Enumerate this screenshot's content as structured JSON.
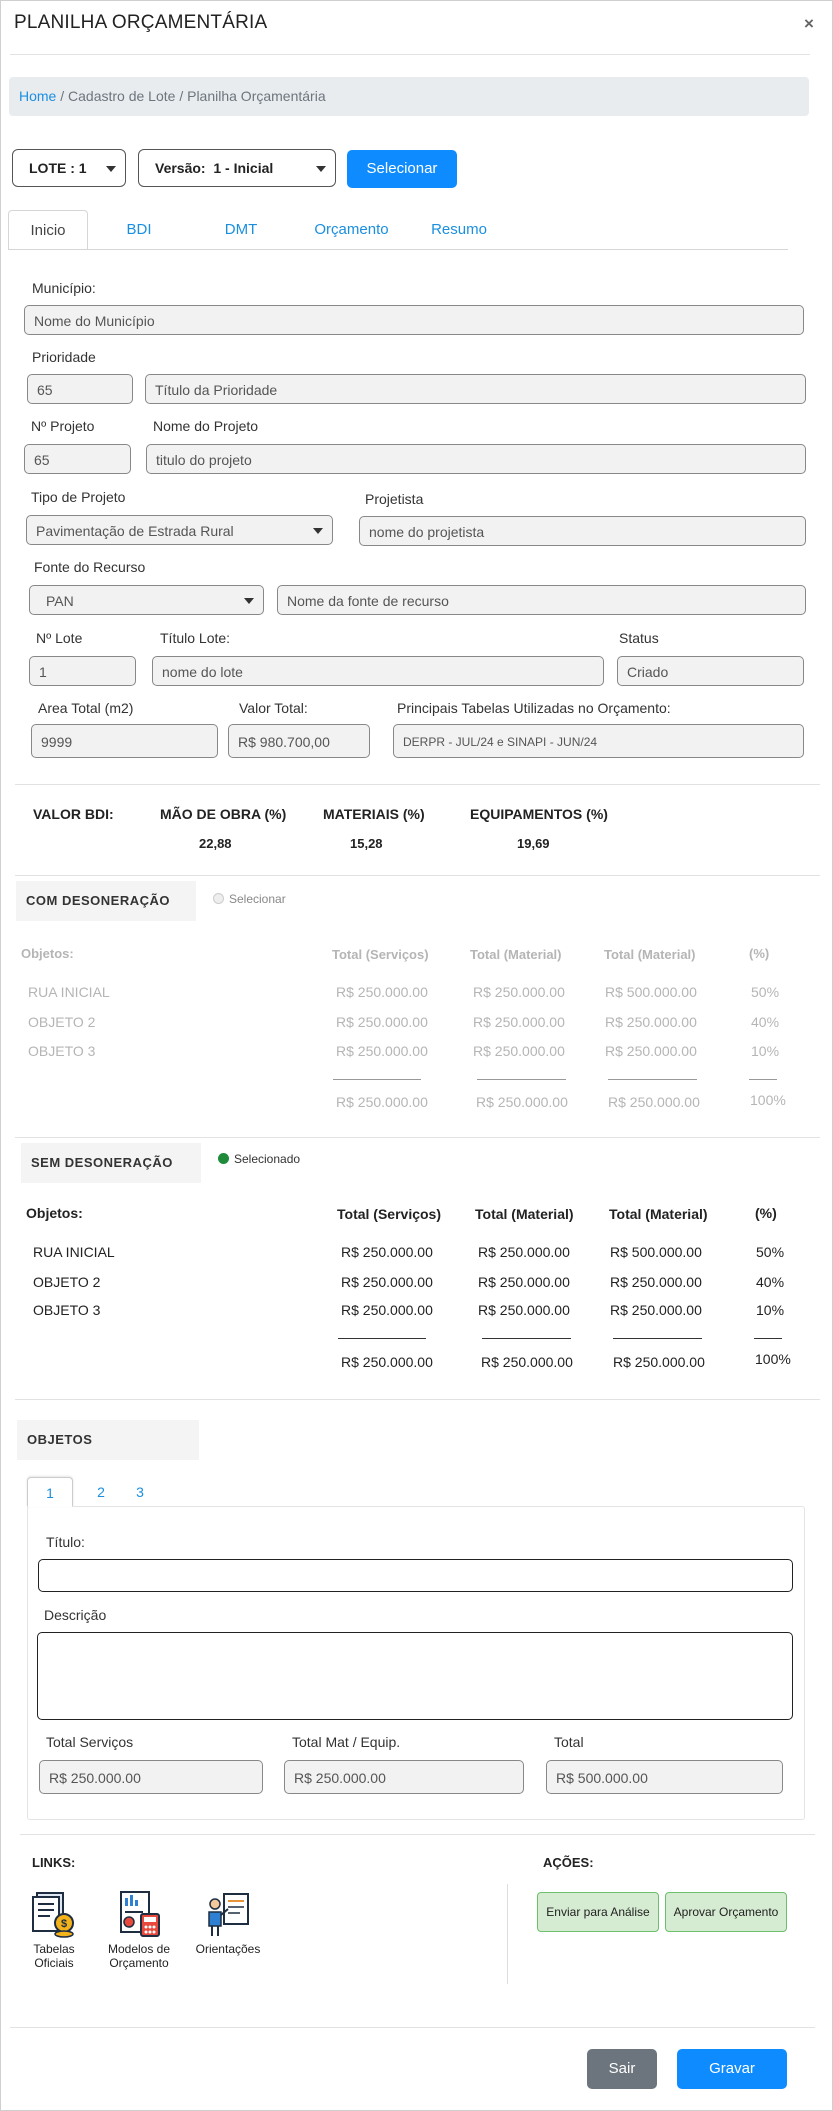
{
  "header": {
    "title": "PLANILHA ORÇAMENTÁRIA",
    "close": "×"
  },
  "breadcrumb": {
    "home": "Home",
    "rest": " / Cadastro de Lote / Planilha Orçamentária"
  },
  "selectors": {
    "lote": "LOTE : 1",
    "versao_label": "Versão:",
    "versao_value": "1 - Inicial",
    "select_button": "Selecionar"
  },
  "tabs": [
    {
      "label": "Inicio"
    },
    {
      "label": "BDI"
    },
    {
      "label": "DMT"
    },
    {
      "label": "Orçamento"
    },
    {
      "label": "Resumo"
    }
  ],
  "form": {
    "municipio_label": "Município:",
    "municipio": "Nome do Município",
    "prioridade_label": "Prioridade",
    "prioridade": "65",
    "prioridade_titulo": "Título da Prioridade",
    "nprojeto_label": "Nº Projeto",
    "nprojeto": "65",
    "nome_projeto_label": "Nome do Projeto",
    "nome_projeto": "titulo do projeto",
    "tipo_projeto_label": "Tipo de Projeto",
    "tipo_projeto": "Pavimentação de Estrada Rural",
    "projetista_label": "Projetista",
    "projetista": "nome do projetista",
    "fonte_label": "Fonte do Recurso",
    "fonte": "PAN",
    "fonte_nome": "Nome da fonte de recurso",
    "nlote_label": "Nº Lote",
    "nlote": "1",
    "titulo_lote_label": "Título Lote:",
    "titulo_lote": "nome do lote",
    "status_label": "Status",
    "status": "Criado",
    "area_label": "Area Total (m2)",
    "area": "9999",
    "valor_label": "Valor Total:",
    "valor": "R$ 980.700,00",
    "tabelas_label": "Principais Tabelas Utilizadas no Orçamento:",
    "tabelas": "DERPR - JUL/24 e SINAPI - JUN/24"
  },
  "bdi": {
    "valor_label": "VALOR BDI:",
    "mao_label": "MÃO DE OBRA (%)",
    "mao": "22,88",
    "mat_label": "MATERIAIS (%)",
    "mat": "15,28",
    "equip_label": "EQUIPAMENTOS (%)",
    "equip": "19,69"
  },
  "com_desoneracao": {
    "title": "COM DESONERAÇÃO",
    "radio": "Selecionar",
    "headers": [
      "Objetos:",
      "Total (Serviços)",
      "Total (Material)",
      "Total (Material)",
      "(%)"
    ],
    "rows": [
      [
        "RUA INICIAL",
        "R$ 250.000.00",
        "R$ 250.000.00",
        "R$ 500.000.00",
        "50%"
      ],
      [
        "OBJETO 2",
        "R$ 250.000.00",
        "R$ 250.000.00",
        "R$ 250.000.00",
        "40%"
      ],
      [
        "OBJETO 3",
        "R$ 250.000.00",
        "R$ 250.000.00",
        "R$ 250.000.00",
        "10%"
      ]
    ],
    "totals": [
      "R$ 250.000.00",
      "R$ 250.000.00",
      "R$ 250.000.00",
      "100%"
    ]
  },
  "sem_desoneracao": {
    "title": "SEM DESONERAÇÃO",
    "radio": "Selecionado",
    "headers": [
      "Objetos:",
      "Total (Serviços)",
      "Total (Material)",
      "Total (Material)",
      "(%)"
    ],
    "rows": [
      [
        "RUA INICIAL",
        "R$ 250.000.00",
        "R$ 250.000.00",
        "R$ 500.000.00",
        "50%"
      ],
      [
        "OBJETO 2",
        "R$ 250.000.00",
        "R$ 250.000.00",
        "R$ 250.000.00",
        "40%"
      ],
      [
        "OBJETO 3",
        "R$ 250.000.00",
        "R$ 250.000.00",
        "R$ 250.000.00",
        "10%"
      ]
    ],
    "totals": [
      "R$ 250.000.00",
      "R$ 250.000.00",
      "R$ 250.000.00",
      "100%"
    ]
  },
  "objetos": {
    "title": "OBJETOS",
    "tabs": [
      "1",
      "2",
      "3"
    ],
    "titulo_label": "Título:",
    "titulo": "",
    "descricao_label": "Descrição",
    "descricao": "",
    "total_serv_label": "Total Serviços",
    "total_serv": "R$ 250.000.00",
    "total_mat_label": "Total Mat / Equip.",
    "total_mat": "R$ 250.000.00",
    "total_label": "Total",
    "total": "R$ 500.000.00"
  },
  "links": {
    "title": "LINKS:",
    "items": [
      {
        "label": "Tabelas\nOficiais",
        "icon": "document-coin-icon"
      },
      {
        "label": "Modelos de\nOrçamento",
        "icon": "calculator-report-icon"
      },
      {
        "label": "Orientações",
        "icon": "presenter-board-icon"
      }
    ]
  },
  "acoes": {
    "title": "AÇÕES:",
    "enviar": "Enviar para Análise",
    "aprovar": "Aprovar Orçamento"
  },
  "footer": {
    "sair": "Sair",
    "gravar": "Gravar"
  },
  "colors": {
    "primary": "#0d8bff",
    "link": "#1a8fe0",
    "success_bg": "#d6ecd2",
    "success_border": "#6cbf6c",
    "selected_dot": "#1e8b3a"
  }
}
